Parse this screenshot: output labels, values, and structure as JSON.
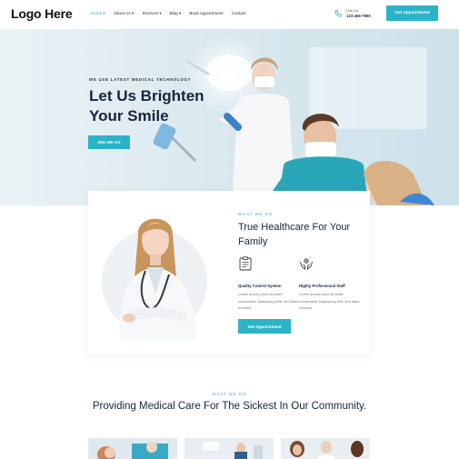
{
  "header": {
    "logo": "Logo Here",
    "nav": [
      {
        "label": "Home ▾",
        "active": true
      },
      {
        "label": "About Us ▾",
        "active": false
      },
      {
        "label": "Services ▾",
        "active": false
      },
      {
        "label": "Blog ▾",
        "active": false
      },
      {
        "label": "Book Appointment",
        "active": false
      },
      {
        "label": "Contact",
        "active": false
      }
    ],
    "call_label": "Call Us",
    "call_number": "123-456-7890",
    "cta": "Get Appointment"
  },
  "hero": {
    "eyebrow": "WE USE LATEST MEDICAL TECHNOLOGY",
    "title": "Let Us Brighten Your Smile",
    "button": "Who We Are"
  },
  "about": {
    "eyebrow": "WHAT WE DO",
    "title": "True Healthcare For Your Family",
    "features": [
      {
        "icon": "clipboard-icon",
        "title": "Quality Control System",
        "text": "Lorem ipsum dolor sit amet, consectetur sadipscing elitr, sed diam nonumy"
      },
      {
        "icon": "care-hands-icon",
        "title": "Highly Professional Staff",
        "text": "Lorem ipsum dolor sit amet, consectetur sadipscing elitr, sed diam nonumy"
      }
    ],
    "button": "Get Appointment"
  },
  "services": {
    "eyebrow": "WHAT WE DO",
    "title": "Providing Medical Care For The Sickest In Our Community."
  },
  "colors": {
    "accent": "#2bb3c8",
    "heading": "#16263a"
  }
}
